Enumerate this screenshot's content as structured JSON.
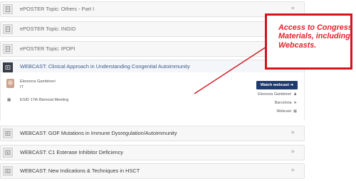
{
  "rows_top": [
    {
      "label": "ePOSTER Topic: Others - Part I",
      "icon": "document-icon",
      "chevron": "»"
    },
    {
      "label": "ePOSTER Topic: INGID",
      "icon": "document-icon",
      "chevron": "»"
    },
    {
      "label": "ePOSTER Topic: IPOPI",
      "icon": "document-icon",
      "chevron": "»"
    }
  ],
  "active_row": {
    "label": "WEBCAST: Clinical Approach in Understanding Congenital Autoimmunity",
    "icon": "play-icon",
    "chevron": "«"
  },
  "panel": {
    "speaker_name": "Eleonora Gambineri",
    "speaker_country": "IT",
    "event": "ESID 17th Biennial Meeting",
    "watch_label": "Watch webcast ➜",
    "meta_speaker": "Eleonora Gambineri",
    "meta_location": "Barcelona",
    "meta_type": "Webcast"
  },
  "rows_bottom": [
    {
      "label": "WEBCAST: GOF Mutations in Immune Dysregulation/Autoimmunity",
      "icon": "play-icon",
      "chevron": "»"
    },
    {
      "label": "WEBCAST: C1 Esterase Inhibitor Deficiency",
      "icon": "play-icon",
      "chevron": "»"
    },
    {
      "label": "WEBCAST: New Indications & Techniques in HSCT",
      "icon": "play-icon",
      "chevron": "»"
    }
  ],
  "callout": {
    "text": "Access to Congress Materials, including Webcasts."
  },
  "colors": {
    "callout_red": "#e81e27",
    "watch_button": "#1f3a6b"
  }
}
